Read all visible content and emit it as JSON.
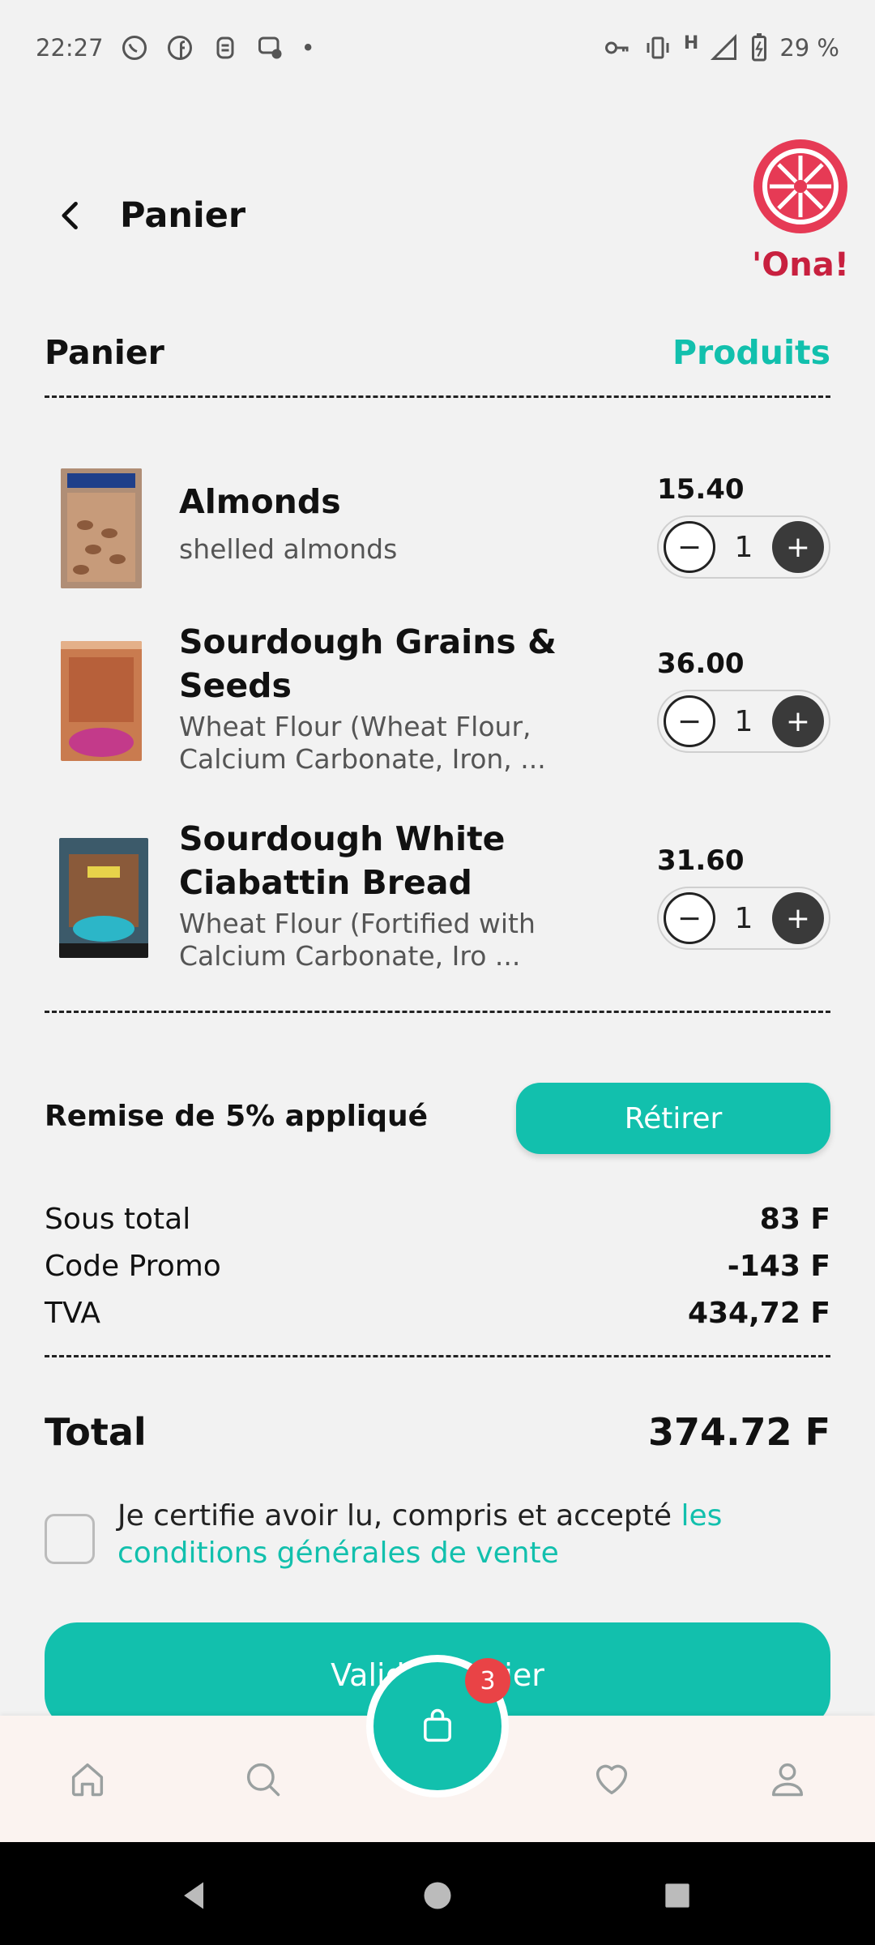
{
  "status_bar": {
    "time": "22:27",
    "battery": "29 %",
    "network": "H",
    "icons": [
      "whatsapp-icon",
      "facebook-icon",
      "notification-icon",
      "messenger-icon",
      "key-icon",
      "vibrate-icon",
      "signal-icon",
      "battery-icon"
    ]
  },
  "header": {
    "title": "Panier",
    "logo_text": "'Ona!"
  },
  "section": {
    "title": "Panier",
    "link": "Produits"
  },
  "items": [
    {
      "name": "Almonds",
      "description": "shelled almonds",
      "price": "15.40",
      "quantity": "1"
    },
    {
      "name": "Sourdough Grains & Seeds",
      "description": "Wheat Flour (Wheat Flour, Calcium Carbonate, Iron, ...",
      "price": "36.00",
      "quantity": "1"
    },
    {
      "name": "Sourdough White Ciabattin Bread",
      "description": "Wheat Flour (Fortified with Calcium Carbonate, Iro ...",
      "price": "31.60",
      "quantity": "1"
    }
  ],
  "discount": {
    "label": "Remise de 5% appliqué",
    "button": "Rétirer"
  },
  "summary": {
    "subtotal_label": "Sous total",
    "subtotal_value": "83 F",
    "promo_label": "Code Promo",
    "promo_value": "-143 F",
    "tva_label": "TVA",
    "tva_value": "434,72 F",
    "total_label": "Total",
    "total_value": "374.72 F"
  },
  "terms": {
    "text": "Je certifie avoir lu, compris et accepté ",
    "link": "les conditions générales de vente",
    "checked": false
  },
  "validate_button": "Valider panier",
  "bottom_nav": {
    "cart_badge": "3",
    "items": [
      "home-icon",
      "search-icon",
      "cart-icon",
      "heart-icon",
      "user-icon"
    ]
  },
  "colors": {
    "accent": "#12c0ad",
    "background": "#f2f2f2",
    "badge": "#e94346",
    "logo_red": "#e63a55"
  }
}
